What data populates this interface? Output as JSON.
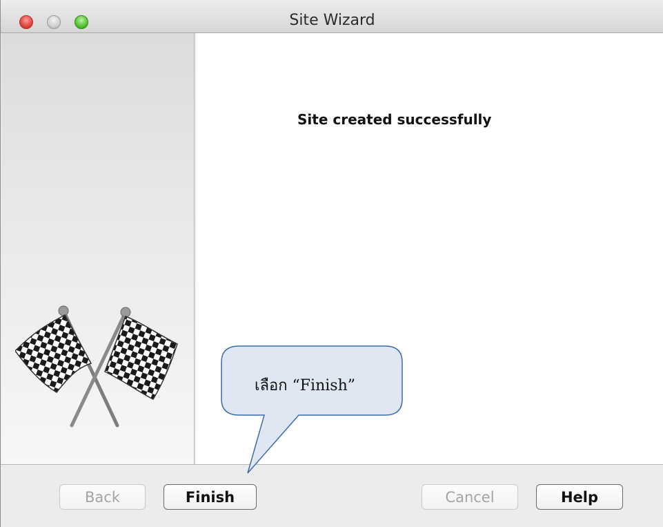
{
  "window": {
    "title": "Site Wizard"
  },
  "content": {
    "message": "Site created successfully"
  },
  "buttons": {
    "back_label": "Back",
    "finish_label": "Finish",
    "cancel_label": "Cancel",
    "help_label": "Help"
  },
  "callout": {
    "text": "เลือก “Finish”",
    "fill_color": "#dfe7f2",
    "stroke_color": "#3d6aa8"
  },
  "icons": {
    "sidebar_graphic": "checkered-flags-icon"
  }
}
